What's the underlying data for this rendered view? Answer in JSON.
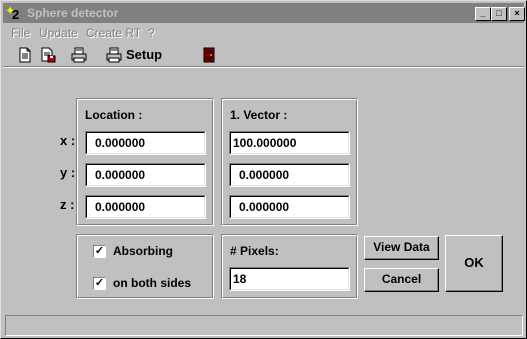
{
  "window": {
    "title": "Sphere detector",
    "app_icon_text": "2",
    "controls": {
      "minimize": "_",
      "maximize": "□",
      "close": "×"
    }
  },
  "menu": {
    "items": [
      {
        "label": "File"
      },
      {
        "label": "Update"
      },
      {
        "label": "Create RT"
      },
      {
        "label": "?"
      }
    ]
  },
  "toolbar": {
    "icons": [
      "new-document-icon",
      "save-document-icon",
      "print-icon",
      "printer-setup-icon",
      "exit-door-icon"
    ],
    "setup_label": "Setup"
  },
  "location": {
    "title": "Location :",
    "labels": {
      "x": "x :",
      "y": "y :",
      "z": "z :"
    },
    "x": "0.000000",
    "y": "0.000000",
    "z": "0.000000"
  },
  "vector": {
    "title": "1. Vector :",
    "x": "100.000000",
    "y": "0.000000",
    "z": "0.000000"
  },
  "options": {
    "absorbing": {
      "label": "Absorbing",
      "checked": true,
      "mark": "✓"
    },
    "both_sides": {
      "label": "on both sides",
      "checked": true,
      "mark": "✓"
    }
  },
  "pixels": {
    "title": "# Pixels:",
    "value": "18"
  },
  "buttons": {
    "view_data": "View Data",
    "cancel": "Cancel",
    "ok": "OK"
  },
  "status": {
    "text": ""
  },
  "colors": {
    "face": "#c0c0c0",
    "titlebar_inactive": "#808080",
    "field_bg": "#ffffff"
  }
}
